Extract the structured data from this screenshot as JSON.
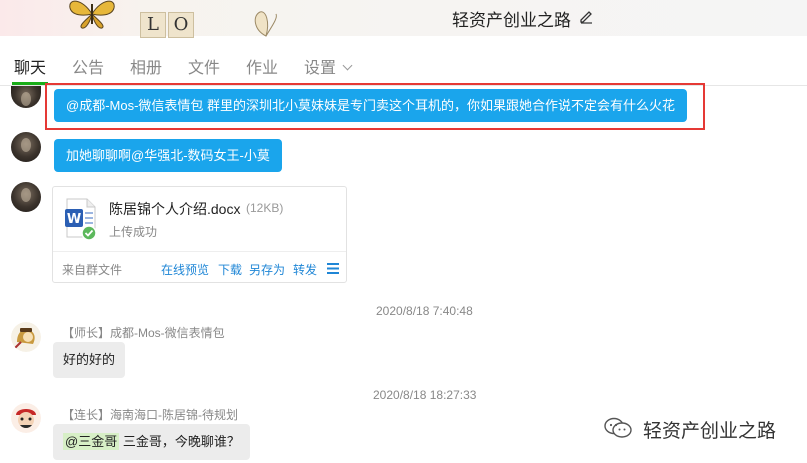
{
  "header": {
    "group_name": "轻资产创业之路",
    "tile_letters": [
      "L",
      "O"
    ]
  },
  "tabs": [
    {
      "label": "聊天",
      "active": true
    },
    {
      "label": "公告"
    },
    {
      "label": "相册"
    },
    {
      "label": "文件"
    },
    {
      "label": "作业"
    },
    {
      "label": "设置"
    }
  ],
  "messages": {
    "m1": {
      "text": "@成都-Mos-微信表情包 群里的深圳北小莫妹妹是专门卖这个耳机的，你如果跟她合作说不定会有什么火花"
    },
    "m2": {
      "text": "加她聊聊啊@华强北-数码女王-小莫"
    },
    "file": {
      "name": "陈居锦个人介绍.docx",
      "size": "(12KB)",
      "status": "上传成功",
      "source": "来自群文件",
      "actions": [
        "在线预览",
        "下载",
        "另存为",
        "转发"
      ]
    },
    "t1": "2020/8/18 7:40:48",
    "m3": {
      "sender": "【师长】成都-Mos-微信表情包",
      "text": "好的好的"
    },
    "t2": "2020/8/18 18:27:33",
    "m4": {
      "sender": "【连长】海南海口-陈居锦-待规划",
      "mention": "@三金哥",
      "text": " 三金哥，今晚聊谁？"
    }
  },
  "watermark": {
    "text": "轻资产创业之路"
  },
  "colors": {
    "accent_blue": "#1aa5ec",
    "tab_active_underline": "#1aad19",
    "highlight_border": "#e53935",
    "link_blue": "#1f86d6"
  }
}
